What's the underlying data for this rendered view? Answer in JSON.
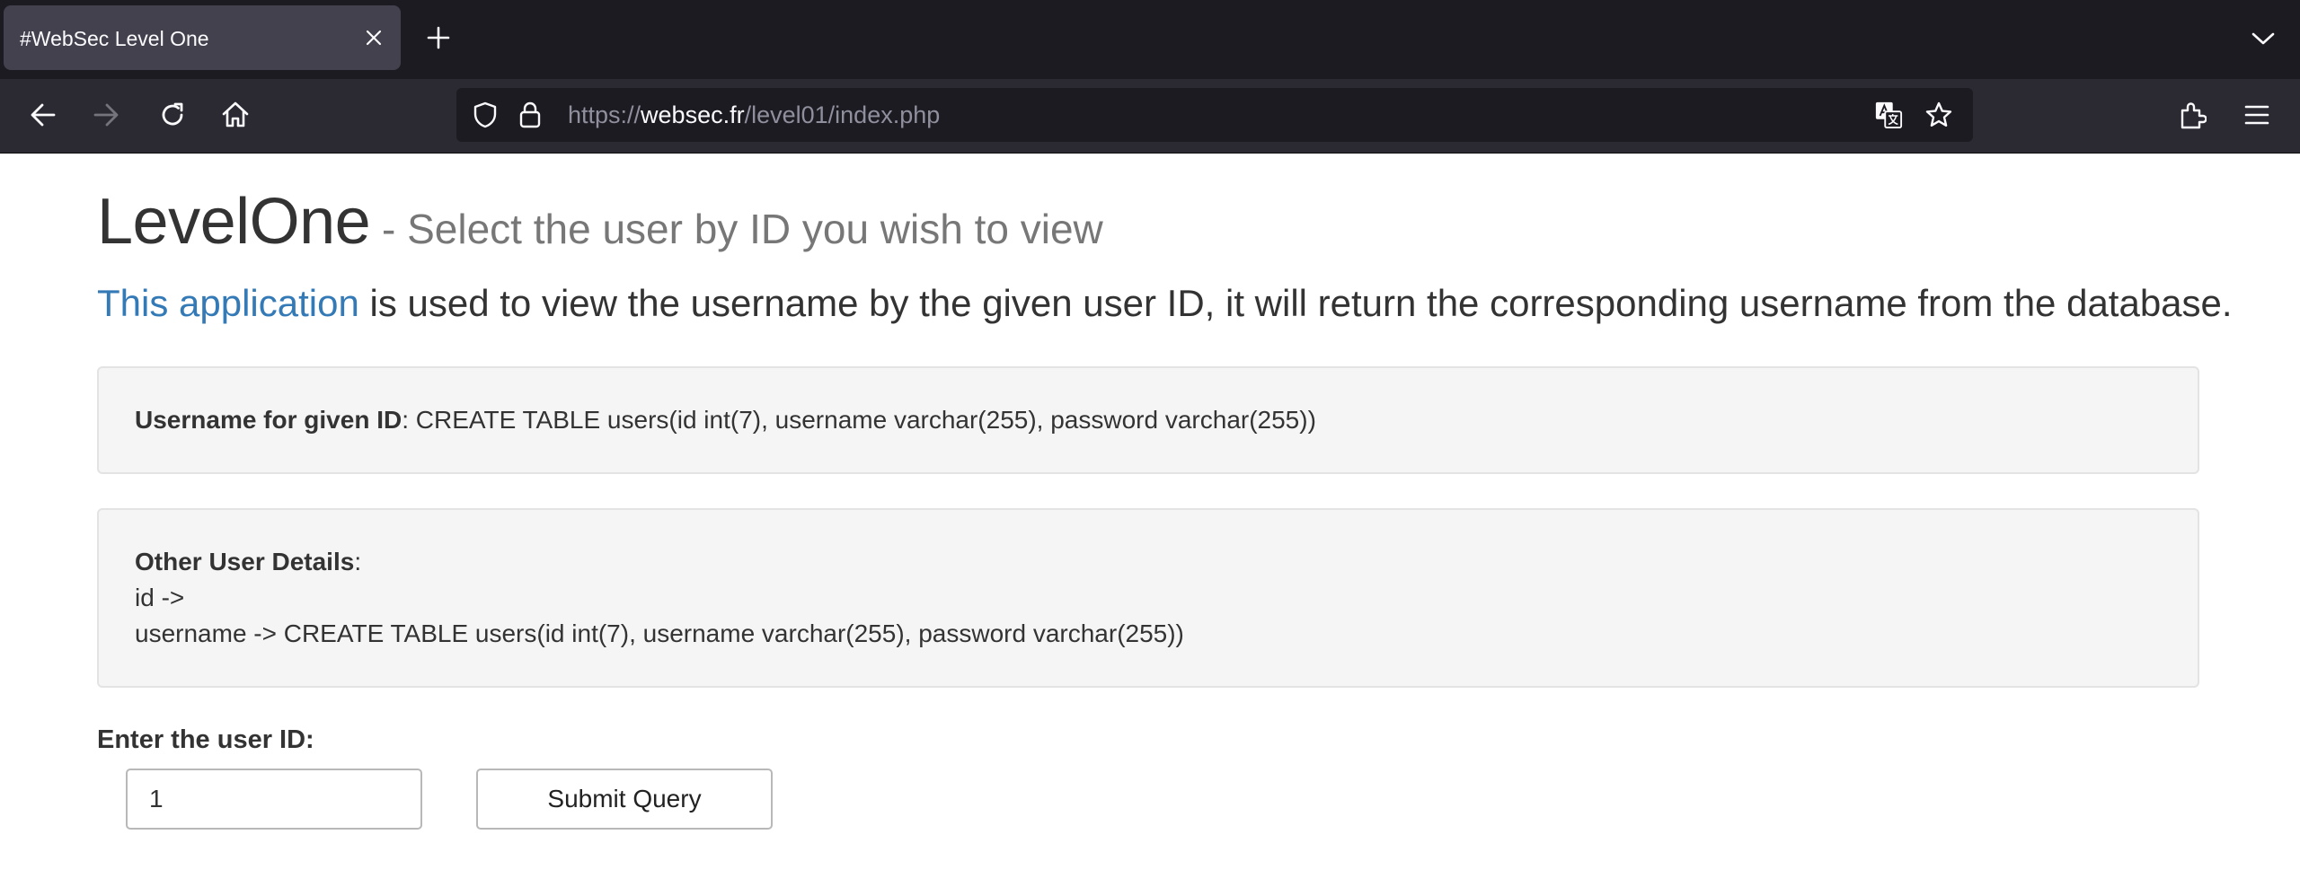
{
  "browser": {
    "tab": {
      "title": "#WebSec Level One"
    },
    "url": {
      "scheme": "https://",
      "host": "websec.fr",
      "path": "/level01/index.php"
    }
  },
  "page": {
    "heading": {
      "main": "LevelOne",
      "sub": " - Select the user by ID you wish to view"
    },
    "lead": {
      "link_text": "This application",
      "rest": " is used to view the username by the given user ID, it will return the corresponding username from the database."
    },
    "result": {
      "label": "Username for given ID",
      "sep": ":",
      "value": " CREATE TABLE users(id int(7), username varchar(255), password varchar(255))"
    },
    "details": {
      "label": "Other User Details",
      "sep": ":",
      "id_line": "id ->",
      "username_line": "username -> CREATE TABLE users(id int(7), username varchar(255), password varchar(255))"
    },
    "form": {
      "label": "Enter the user ID:",
      "input_value": "1",
      "submit_label": "Submit Query"
    }
  }
}
